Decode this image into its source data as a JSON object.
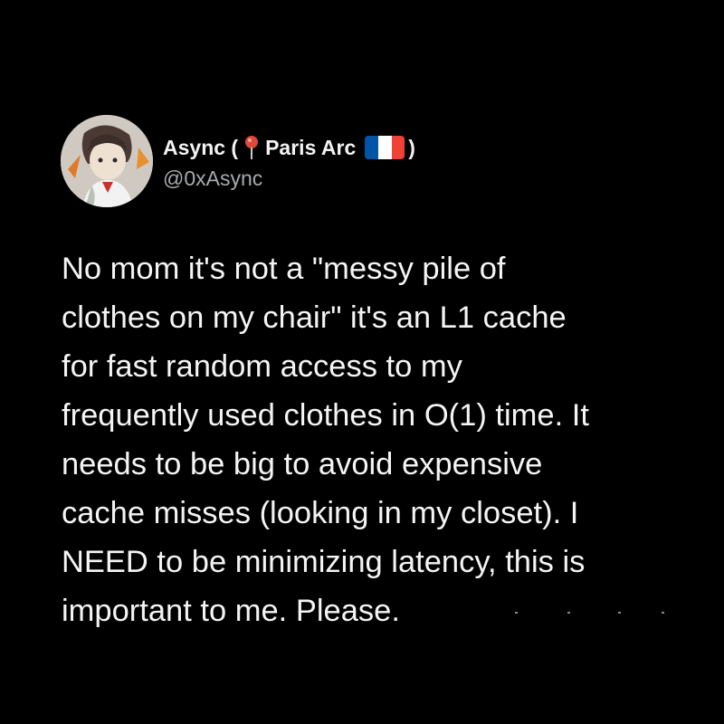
{
  "tweet": {
    "author": {
      "name_prefix": "Async (",
      "location": "Paris Arc",
      "name_suffix": ")",
      "handle": "@0xAsync",
      "pin_icon": "round-pushpin-icon",
      "flag_icon": "france-flag-icon",
      "flag_colors": [
        "#0055A4",
        "#FFFFFF",
        "#EF4135"
      ]
    },
    "more_label": "···",
    "body_lines": [
      "No mom it's not a \"messy pile of",
      "clothes on my chair\" it's an L1 cache",
      "for fast random access to my",
      "frequently used clothes in O(1) time. It",
      "needs to be big to avoid expensive",
      "cache misses (looking in my closet). I",
      "NEED to be minimizing latency, this is",
      "important to me. Please."
    ]
  },
  "colors": {
    "background": "#000000",
    "text": "#f4f4f4",
    "secondary_text": "#a8aaad"
  }
}
